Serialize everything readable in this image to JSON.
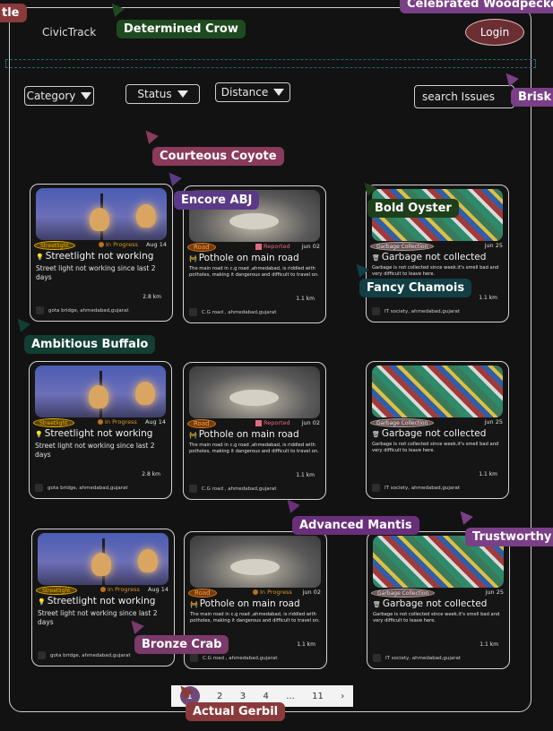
{
  "header": {
    "brand": "CivicTrack",
    "login_label": "Login"
  },
  "filters": {
    "category": "Category",
    "status": "Status",
    "distance": "Distance"
  },
  "search": {
    "placeholder": "search Issues"
  },
  "cards": [
    {
      "image": "street",
      "tag": "Streetlight",
      "status": "In Progress",
      "date": "Aug 14",
      "title": "Streetlight not working",
      "description": "Street light not working since last 2 days",
      "distance": "2.8 km",
      "location": "gota bridge, ahmedabad,gujarat"
    },
    {
      "image": "road",
      "tag": "Road",
      "status": "Reported",
      "date": "jun 02",
      "title": "Pothole on main road",
      "description": "The main road in c.g road ,ahmedabad, is riddled with potholes, making it dangerous and difficult to travel on.",
      "distance": "1.1 km",
      "location": "C.G road , ahmedabad,gujarat"
    },
    {
      "image": "garbage",
      "tag": "Garbage Collection",
      "status": "",
      "date": "jun 25",
      "title": "Garbage not collected",
      "description": "Garbage is not collected since week.it's smell bad and very difficult to leave here.",
      "distance": "1.1 km",
      "location": "IT society, ahmedabad,gujarat"
    },
    {
      "image": "street",
      "tag": "Streetlight",
      "status": "In Progress",
      "date": "Aug 14",
      "title": "Streetlight not working",
      "description": "Street light not working since last 2 days",
      "distance": "2.8 km",
      "location": "gota bridge, ahmedabad,gujarat"
    },
    {
      "image": "road",
      "tag": "Road",
      "status": "Reported",
      "date": "jun 02",
      "title": "Pothole on main road",
      "description": "The main road in c.g road ,ahmedabad, is riddled with potholes, making it dangerous and difficult to travel on.",
      "distance": "1.1 km",
      "location": "C.G road , ahmedabad,gujarat"
    },
    {
      "image": "garbage",
      "tag": "Garbage Collection",
      "status": "",
      "date": "jun 25",
      "title": "Garbage not collected",
      "description": "Garbage is not collected since week.it's smell bad and very difficult to leave here.",
      "distance": "1.1 km",
      "location": "IT society, ahmedabad,gujarat"
    },
    {
      "image": "street",
      "tag": "Streetlight",
      "status": "In Progress",
      "date": "Aug 14",
      "title": "Streetlight not working",
      "description": "Street light not working since last 2 days",
      "distance": "2.8 km",
      "location": "gota bridge, ahmedabad,gujarat"
    },
    {
      "image": "road",
      "tag": "Road",
      "status": "In Progress",
      "date": "jun 02",
      "title": "Pothole on main road",
      "description": "The main road in c.g road ,ahmedabad, is riddled with potholes, making it dangerous and difficult to travel on.",
      "distance": "1.1 km",
      "location": "C.G road , ahmedabad,gujarat"
    },
    {
      "image": "garbage",
      "tag": "Garbage Collection",
      "status": "",
      "date": "jun 25",
      "title": "Garbage not collected",
      "description": "Garbage is not collected since week.it's smell bad and very difficult to leave here.",
      "distance": "1.1 km",
      "location": "IT society, ahmedabad,gujarat"
    }
  ],
  "pagination": {
    "pages": [
      "1",
      "2",
      "3",
      "4",
      "...",
      "11"
    ],
    "current": "1",
    "next": "›"
  },
  "collaborators": [
    {
      "name": "tle",
      "color": "#8a3a3a"
    },
    {
      "name": "Celebrated Woodpecker",
      "color": "#7a3f86"
    },
    {
      "name": "Determined Crow",
      "color": "#1f4a1f"
    },
    {
      "name": "Brisk",
      "color": "#7a3f86"
    },
    {
      "name": "Courteous Coyote",
      "color": "#8a3a5a"
    },
    {
      "name": "Encore ABJ",
      "color": "#5a3a86"
    },
    {
      "name": "Bold Oyster",
      "color": "#1f3f1a"
    },
    {
      "name": "Fancy Chamois",
      "color": "#123e44"
    },
    {
      "name": "Ambitious Buffalo",
      "color": "#123e34"
    },
    {
      "name": "Advanced Mantis",
      "color": "#6a2f7a"
    },
    {
      "name": "Trustworthy",
      "color": "#7a3f86"
    },
    {
      "name": "Bronze Crab",
      "color": "#7a3a6a"
    },
    {
      "name": "Actual Gerbil",
      "color": "#8a3a3a"
    }
  ]
}
